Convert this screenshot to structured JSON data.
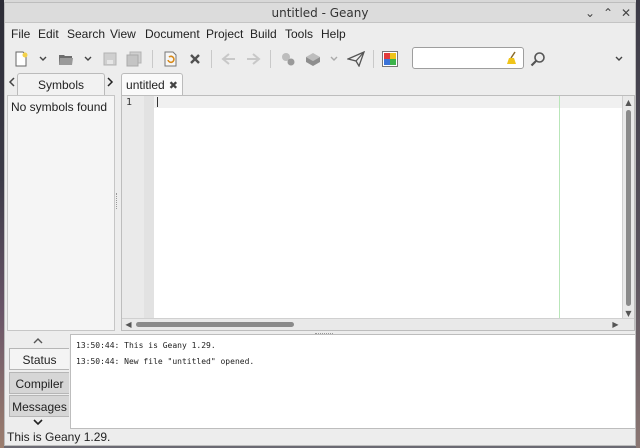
{
  "window": {
    "title": "untitled - Geany",
    "controls": {
      "minimize": "⌄",
      "maximize": "⌃",
      "close": "✕"
    }
  },
  "menubar": {
    "items": [
      "File",
      "Edit",
      "Search",
      "View",
      "Document",
      "Project",
      "Build",
      "Tools",
      "Help"
    ]
  },
  "toolbar": {
    "icons": [
      "new-file-icon",
      "open-file-icon",
      "save-icon",
      "save-all-icon",
      "revert-icon",
      "close-icon",
      "back-icon",
      "forward-icon",
      "compile-icon",
      "build-icon",
      "run-icon",
      "color-chooser-icon",
      "search-icon",
      "overflow-chevron-icon"
    ],
    "search": {
      "value": "",
      "placeholder": ""
    }
  },
  "sidebar": {
    "tab_label": "Symbols",
    "empty_message": "No symbols found"
  },
  "editor": {
    "tab_label": "untitled",
    "close_glyph": "✖",
    "line_number": "1",
    "content": ""
  },
  "messages": {
    "tabs": [
      "Status",
      "Compiler",
      "Messages"
    ],
    "active_tab": "Status",
    "lines": [
      "13:50:44: This is Geany 1.29.",
      "13:50:44: New file \"untitled\" opened."
    ]
  },
  "statusbar": {
    "text": "This is Geany 1.29."
  },
  "colors": {
    "long_line_marker": "#b9e6b9",
    "current_line": "#f0f0f0"
  }
}
